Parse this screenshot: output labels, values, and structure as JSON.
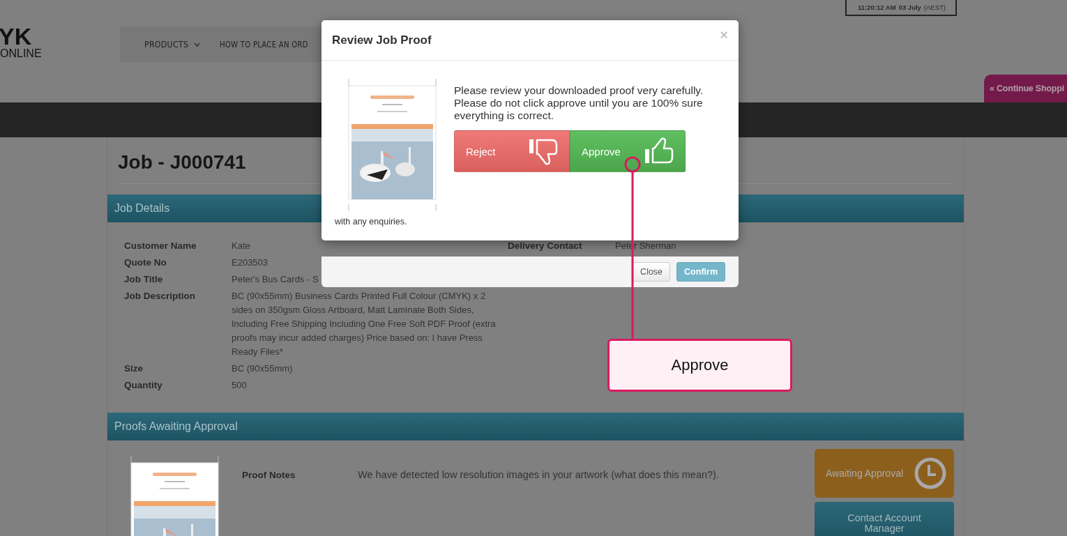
{
  "header": {
    "clock": {
      "time": "11:20:12 AM",
      "date": "03 July",
      "zone": "(AEST)"
    },
    "logo": {
      "line1": "YK",
      "line2": "ONLINE"
    },
    "nav": [
      {
        "label": "PRODUCTS",
        "has_menu": true
      },
      {
        "label": "HOW TO PLACE AN ORD",
        "has_menu": false
      }
    ],
    "continue_button": "« Continue Shoppi"
  },
  "job": {
    "title": "Job - J000741",
    "details_heading": "Job Details",
    "details": [
      {
        "label": "Customer Name",
        "value": "Kate"
      },
      {
        "label": "Quote No",
        "value": "E203503"
      },
      {
        "label": "Job Title",
        "value": "Peter's Bus Cards - S"
      },
      {
        "label": "Job Description",
        "value": "BC (90x55mm) Business Cards Printed Full Colour (CMYK) x 2 sides on 350gsm Gloss Artboard, Matt Laminate Both Sides, Including Free Shipping Including One Free Soft PDF Proof (extra proofs may incur added charges) Price based on: I have Press Ready Files*"
      },
      {
        "label": "Size",
        "value": "BC (90x55mm)"
      },
      {
        "label": "Quantity",
        "value": "500"
      }
    ],
    "delivery": [
      {
        "label": "Delivery Contact",
        "value": "Peter Sherman"
      }
    ],
    "proofs_heading": "Proofs Awaiting Approval",
    "proof": {
      "kind": "picture",
      "notes_label": "Proof Notes",
      "notes": "We have detected low resolution images in your artwork (what does this mean?).",
      "status": "Awaiting Approval",
      "contact_button": "Contact Account Manager"
    }
  },
  "modal": {
    "title": "Review Job Proof",
    "close": "×",
    "message": "Please review your downloaded proof very carefully. Please do not click approve until you are 100% sure everything is correct.",
    "buttons": [
      {
        "label": "Reject",
        "kind": "reject"
      },
      {
        "label": "Approve",
        "kind": "approve"
      }
    ],
    "footnote": "with any enquiries.",
    "footer_buttons": [
      {
        "label": "Close",
        "kind": "default"
      },
      {
        "label": "Confirm",
        "kind": "primary"
      }
    ]
  },
  "callout": {
    "text": "Approve"
  }
}
